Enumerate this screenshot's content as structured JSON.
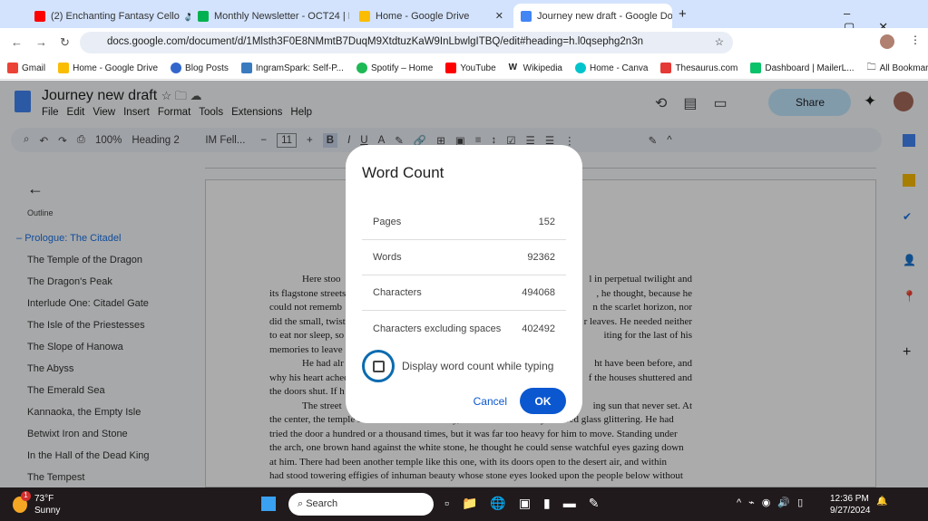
{
  "tabs": [
    {
      "label": "(2) Enchanting Fantasy Cello",
      "color": "#ff0000"
    },
    {
      "label": "Monthly Newsletter - OCT24 | D",
      "color": "#00b14f"
    },
    {
      "label": "Home - Google Drive",
      "color": "#fbbc04"
    },
    {
      "label": "Journey new draft - Google Doc",
      "color": "#4285f4"
    }
  ],
  "url": "docs.google.com/document/d/1Mlsth3F0E8NMmtB7DuqM9XtdtuzKaW9InLbwlgITBQ/edit#heading=h.l0qsephg2n3n",
  "bookmarks": [
    "Gmail",
    "Home - Google Drive",
    "Blog Posts",
    "IngramSpark: Self-P...",
    "Spotify – Home",
    "YouTube",
    "Wikipedia",
    "Home - Canva",
    "Thesaurus.com",
    "Dashboard | MailerL..."
  ],
  "all_bookmarks": "All Bookmarks",
  "doc": {
    "title": "Journey new draft",
    "menu": [
      "File",
      "Edit",
      "View",
      "Insert",
      "Format",
      "Tools",
      "Extensions",
      "Help"
    ],
    "share": "Share"
  },
  "toolbar": {
    "zoom": "100%",
    "style": "Heading 2",
    "font": "IM Fell...",
    "size": "11"
  },
  "outline": {
    "label": "Outline",
    "items": [
      "Prologue: The Citadel",
      "The Temple of the Dragon",
      "The Dragon's Peak",
      "Interlude One: Citadel Gate",
      "The Isle of the Priestesses",
      "The Slope of Hanowa",
      "The Abyss",
      "The Emerald Sea",
      "Kannaoka, the Empty Isle",
      "Betwixt Iron and Stone",
      "In the Hall of the Dead King",
      "The Tempest"
    ]
  },
  "text": [
    [
      "Here stoo",
      "l in perpetual twilight and"
    ],
    [
      "its flagstone streets",
      ", he thought, because he"
    ],
    [
      "could not rememb",
      "n the scarlet horizon, nor"
    ],
    [
      "did the small, twist",
      "r leaves. He needed neither"
    ],
    [
      "to eat nor sleep, so",
      "iting for the last of his"
    ],
    [
      "memories to leave",
      ""
    ],
    [
      "He had alr",
      "ht have been before, and"
    ],
    [
      "why his heart ached",
      "f the houses shuttered and"
    ],
    [
      "the doors shut. If h",
      ""
    ],
    [
      "The street",
      "ing sun that never set. At"
    ],
    [
      "the center, the temple stood watch over the city, its windows of many-colored glass glittering. He had",
      ""
    ],
    [
      "tried the door a hundred or a thousand times, but it was far too heavy for him to move. Standing under",
      ""
    ],
    [
      "the arch, one brown hand against the white stone, he thought he could sense watchful eyes gazing down",
      ""
    ],
    [
      "at him. There had been another temple like this one, with its doors open to the desert air, and within",
      ""
    ],
    [
      "had stood towering effigies of inhuman beauty whose stone eyes looked upon the people below without",
      ""
    ]
  ],
  "dialog": {
    "title": "Word Count",
    "rows": [
      {
        "label": "Pages",
        "value": "152"
      },
      {
        "label": "Words",
        "value": "92362"
      },
      {
        "label": "Characters",
        "value": "494068"
      },
      {
        "label": "Characters excluding spaces",
        "value": "402492"
      }
    ],
    "checkbox": "Display word count while typing",
    "cancel": "Cancel",
    "ok": "OK"
  },
  "taskbar": {
    "temp": "73°F",
    "weather": "Sunny",
    "badge": "1",
    "search": "Search",
    "time": "12:36 PM",
    "date": "9/27/2024"
  }
}
